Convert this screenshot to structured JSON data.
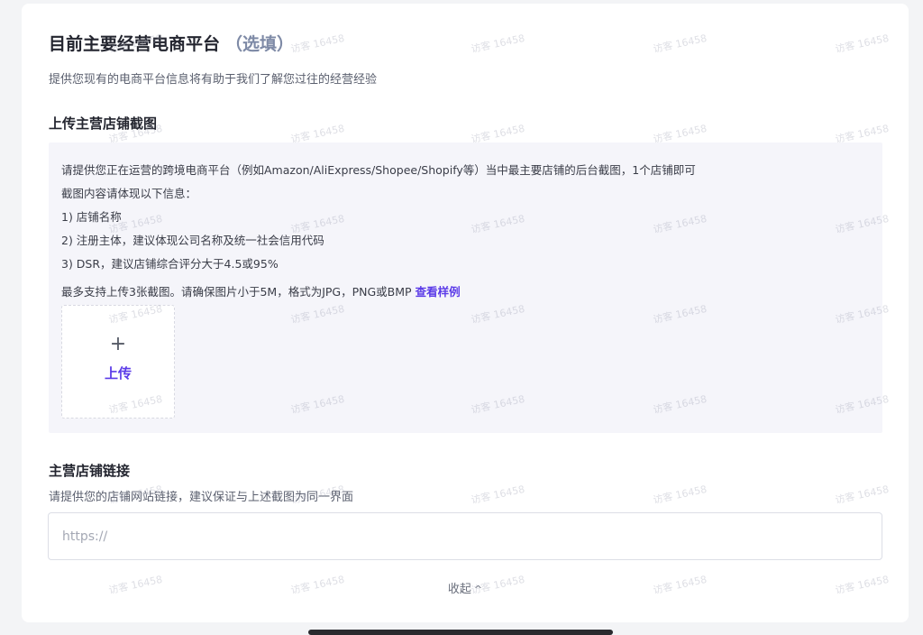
{
  "platform": {
    "title": "目前主要经营电商平台",
    "optional": "（选填）",
    "subtitle": "提供您现有的电商平台信息将有助于我们了解您过往的经营经验"
  },
  "screenshot_section": {
    "title": "上传主营店铺截图",
    "instructions": [
      "请提供您正在运营的跨境电商平台（例如Amazon/AliExpress/Shopee/Shopify等）当中最主要店铺的后台截图，1个店铺即可",
      "截图内容请体现以下信息：",
      "1) 店铺名称",
      "2) 注册主体，建议体现公司名称及统一社会信用代码",
      "3) DSR，建议店铺综合评分大于4.5或95%"
    ],
    "limit_text": "最多支持上传3张截图。请确保图片小于5M，格式为JPG，PNG或BMP",
    "sample_link": "查看样例",
    "upload_label": "上传",
    "upload_icon": "plus-icon"
  },
  "link_section": {
    "title": "主营店铺链接",
    "description": "请提供您的店铺网站链接，建议保证与上述截图为同一界面",
    "input_value": "",
    "input_placeholder": "https://"
  },
  "collapse": {
    "label": "收起",
    "icon": "chevron-up-icon"
  },
  "watermark": {
    "text": "访客 16458"
  },
  "colors": {
    "accent": "#5b3be8",
    "optional_text": "#7e8aa6",
    "panel_bg": "#f5f5fa"
  }
}
